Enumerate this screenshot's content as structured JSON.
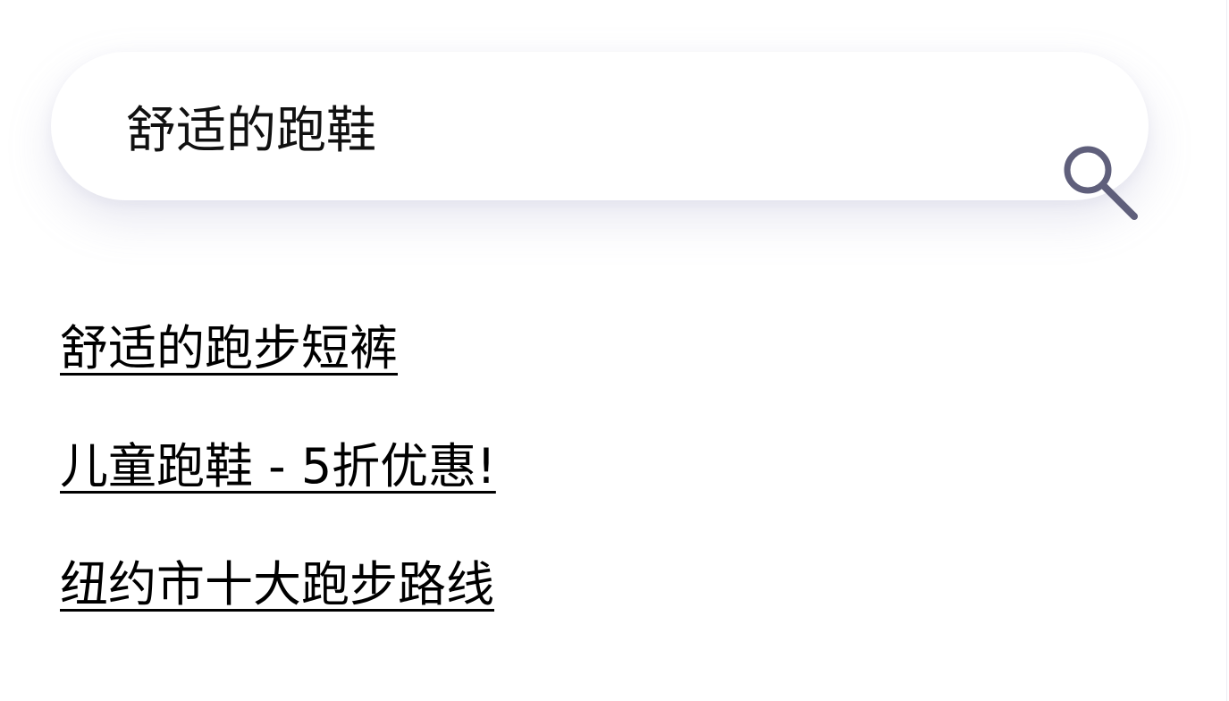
{
  "search": {
    "value": "舒适的跑鞋",
    "icon": "search-icon"
  },
  "suggestions": [
    {
      "label": "舒适的跑步短裤"
    },
    {
      "label": "儿童跑鞋 - 5折优惠!"
    },
    {
      "label": "纽约市十大跑步路线"
    }
  ],
  "colors": {
    "icon": "#5f5f7b",
    "text": "#000000",
    "background": "#ffffff"
  }
}
